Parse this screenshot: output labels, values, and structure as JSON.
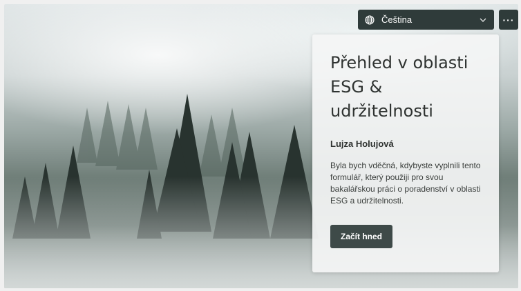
{
  "language": {
    "selected": "Čeština",
    "icon": "globe-icon"
  },
  "menu": {
    "more_label": "···"
  },
  "card": {
    "title": "Přehled v oblasti ESG & udržitelnosti",
    "author": "Lujza Holujová",
    "description": "Byla bych vděčná, kdybyste vyplnili tento formulář, který použiji pro svou bakalářskou práci o poradenství v oblasti ESG a udržitelnosti.",
    "start_button": "Začít hned"
  },
  "colors": {
    "accent": "#3e4a48",
    "pill": "#2f3b3a"
  }
}
